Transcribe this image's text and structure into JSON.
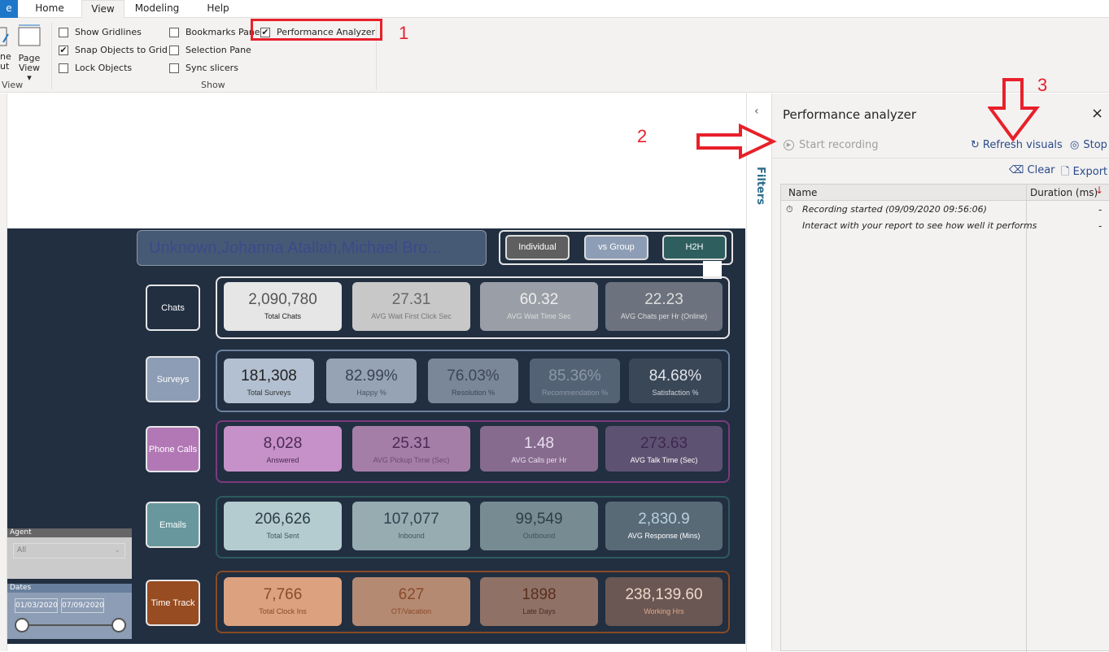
{
  "tabs": [
    {
      "label": "e"
    },
    {
      "label": "Home"
    },
    {
      "label": "View"
    },
    {
      "label": "Modeling"
    },
    {
      "label": "Help"
    }
  ],
  "ribbon": {
    "view_group": {
      "label": "View",
      "btn1": "ne\nut",
      "page_view": "Page View ▾"
    },
    "show_group": {
      "label": "Show",
      "checkboxes": [
        {
          "label": "Show Gridlines",
          "checked": false
        },
        {
          "label": "Snap Objects to Grid",
          "checked": true
        },
        {
          "label": "Lock Objects",
          "checked": false
        },
        {
          "label": "Bookmarks Pane",
          "checked": false
        },
        {
          "label": "Selection Pane",
          "checked": false
        },
        {
          "label": "Sync slicers",
          "checked": false
        },
        {
          "label": "Performance Analyzer",
          "checked": true
        }
      ]
    }
  },
  "annotations": {
    "n1": "1",
    "n2": "2",
    "n3": "3",
    "color": "#e8202a"
  },
  "report": {
    "agent_title": "Unknown,Johanna Atallah,Michael Bro...",
    "view_buttons": [
      {
        "label": "Individual",
        "bg": "#5f5f5f"
      },
      {
        "label": "vs Group",
        "bg": "#8d9db5"
      },
      {
        "label": "H2H",
        "bg": "#2f5e5e"
      }
    ],
    "rows": [
      {
        "label": "Chats",
        "labelBg": "#212f41",
        "border": "#e6e6e6",
        "cards": [
          {
            "value": "2,090,780",
            "label": "Total Chats",
            "bg": "#e6e6e6",
            "vc": "#555",
            "lc": "#222"
          },
          {
            "value": "27.31",
            "label": "AVG Wait First Click Sec",
            "bg": "#c8c8c8",
            "vc": "#666",
            "lc": "#777"
          },
          {
            "value": "60.32",
            "label": "AVG Wait Time Sec",
            "bg": "#9a9ea6",
            "vc": "#eee",
            "lc": "#ddd"
          },
          {
            "value": "22.23",
            "label": "AVG Chats per Hr (Online)",
            "bg": "#6c737e",
            "vc": "#ddd",
            "lc": "#ddd"
          }
        ]
      },
      {
        "label": "Surveys",
        "labelBg": "#8d9db5",
        "border": "#6b819e",
        "cards": [
          {
            "value": "181,308",
            "label": "Total Surveys",
            "bg": "#b3c0d1",
            "vc": "#222",
            "lc": "#333"
          },
          {
            "value": "82.99%",
            "label": "Happy %",
            "bg": "#96a3b5",
            "vc": "#3a4256",
            "lc": "#4a5266"
          },
          {
            "value": "76.03%",
            "label": "Resolution %",
            "bg": "#7a8799",
            "vc": "#3c4658",
            "lc": "#3c4658"
          },
          {
            "value": "85.36%",
            "label": "Recommendation %",
            "bg": "#536274",
            "vc": "#8d98aa",
            "lc": "#8d98aa"
          },
          {
            "value": "84.68%",
            "label": "Satisfaction %",
            "bg": "#3a4757",
            "vc": "#e0e4ea",
            "lc": "#d0d4da"
          }
        ]
      },
      {
        "label": "Phone Calls",
        "labelBg": "#b277b5",
        "border": "#7c3a7e",
        "cards": [
          {
            "value": "8,028",
            "label": "Answered",
            "bg": "#c691c8",
            "vc": "#4a2a55",
            "lc": "#4a2a55"
          },
          {
            "value": "25.31",
            "label": "AVG Pickup Time (Sec)",
            "bg": "#a57ea8",
            "vc": "#4a2a55",
            "lc": "#6d4a72"
          },
          {
            "value": "1.48",
            "label": "AVG Calls per Hr",
            "bg": "#866b8e",
            "vc": "#eadcef",
            "lc": "#eadcef"
          },
          {
            "value": "273.63",
            "label": "AVG Talk Time (Sec)",
            "bg": "#5e5272",
            "vc": "#3e2850",
            "lc": "#ffffff"
          }
        ]
      },
      {
        "label": "Emails",
        "labelBg": "#68989d",
        "border": "#2d5a5c",
        "cards": [
          {
            "value": "206,626",
            "label": "Total Sent",
            "bg": "#b4cbcf",
            "vc": "#2a3e48",
            "lc": "#3e5660"
          },
          {
            "value": "107,077",
            "label": "Inbound",
            "bg": "#97acb0",
            "vc": "#2c4450",
            "lc": "#3e5660"
          },
          {
            "value": "99,549",
            "label": "Outbound",
            "bg": "#778b92",
            "vc": "#2c3e48",
            "lc": "#3e5660"
          },
          {
            "value": "2,830.9",
            "label": "AVG Response (Mins)",
            "bg": "#596a77",
            "vc": "#b6d0dc",
            "lc": "#ffffff"
          }
        ]
      },
      {
        "label": "Time Track",
        "labelBg": "#974c21",
        "border": "#8a4a24",
        "cards": [
          {
            "value": "7,766",
            "label": "Total Clock Ins",
            "bg": "#dca27f",
            "vc": "#8a4a2a",
            "lc": "#8a4a2a"
          },
          {
            "value": "627",
            "label": "OT/Vacation",
            "bg": "#b58a72",
            "vc": "#8a4a2a",
            "lc": "#8a4a2a"
          },
          {
            "value": "1898",
            "label": "Late Days",
            "bg": "#8f7265",
            "vc": "#5a2e1e",
            "lc": "#4a2e24"
          },
          {
            "value": "238,139.60",
            "label": "Working Hrs",
            "bg": "#6a5753",
            "vc": "#f0d8cc",
            "lc": "#e2a888"
          }
        ]
      }
    ],
    "agent_slicer": {
      "title": "Agent",
      "value": "All"
    },
    "dates_slicer": {
      "title": "Dates",
      "start": "01/03/2020",
      "end": "07/09/2020"
    }
  },
  "filters": {
    "label": "Filters"
  },
  "perf": {
    "title": "Performance analyzer",
    "start": "Start recording",
    "refresh": "Refresh visuals",
    "stop": "Stop",
    "clear": "Clear",
    "export": "Export",
    "col_name": "Name",
    "col_duration": "Duration (ms)",
    "rows": [
      {
        "name": "Recording started (09/09/2020 09:56:06)",
        "duration": "-"
      },
      {
        "name": "Interact with your report to see how well it performs",
        "duration": "-"
      }
    ]
  }
}
